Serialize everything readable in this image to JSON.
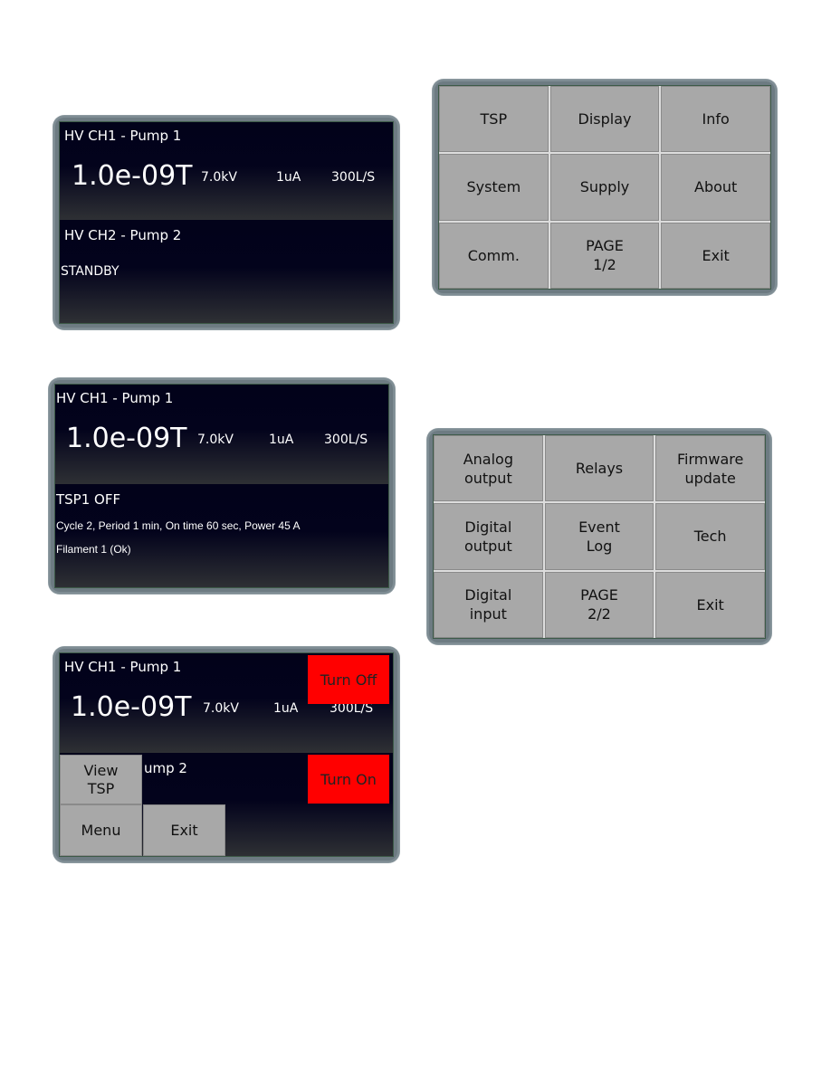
{
  "screen1": {
    "ch1": {
      "title": "HV CH1 - Pump 1",
      "pressure": "1.0e-09T",
      "voltage": "7.0kV",
      "current": "1uA",
      "speed": "300L/S"
    },
    "ch2": {
      "title": "HV CH2 - Pump 2",
      "status": "STANDBY"
    }
  },
  "menu1": {
    "buttons": [
      "TSP",
      "Display",
      "Info",
      "System",
      "Supply",
      "About",
      "Comm.",
      "PAGE\n1/2",
      "Exit"
    ]
  },
  "screen2": {
    "ch1": {
      "title": "HV CH1 - Pump 1",
      "pressure": "1.0e-09T",
      "voltage": "7.0kV",
      "current": "1uA",
      "speed": "300L/S"
    },
    "tsp": {
      "title": "TSP1 OFF",
      "details": "Cycle 2, Period 1 min, On time 60 sec, Power 45 A",
      "filament": "Filament 1 (Ok)"
    }
  },
  "menu2": {
    "buttons": [
      "Analog\noutput",
      "Relays",
      "Firmware\nupdate",
      "Digital\noutput",
      "Event\nLog",
      "Tech",
      "Digital\ninput",
      "PAGE\n2/2",
      "Exit"
    ]
  },
  "screen3": {
    "ch1": {
      "title": "HV CH1 - Pump 1",
      "pressure": "1.0e-09T",
      "voltage": "7.0kV",
      "current": "1uA",
      "speed": "300L/S"
    },
    "ch2_partial": "ump 2",
    "turn_off": "Turn Off",
    "turn_on": "Turn On",
    "view_tsp": "View\nTSP",
    "menu": "Menu",
    "exit": "Exit"
  },
  "colors": {
    "screen_bg": "#02021a",
    "bezel": "#6d7b82",
    "button": "#a8a8a8",
    "danger": "#ff0000"
  }
}
